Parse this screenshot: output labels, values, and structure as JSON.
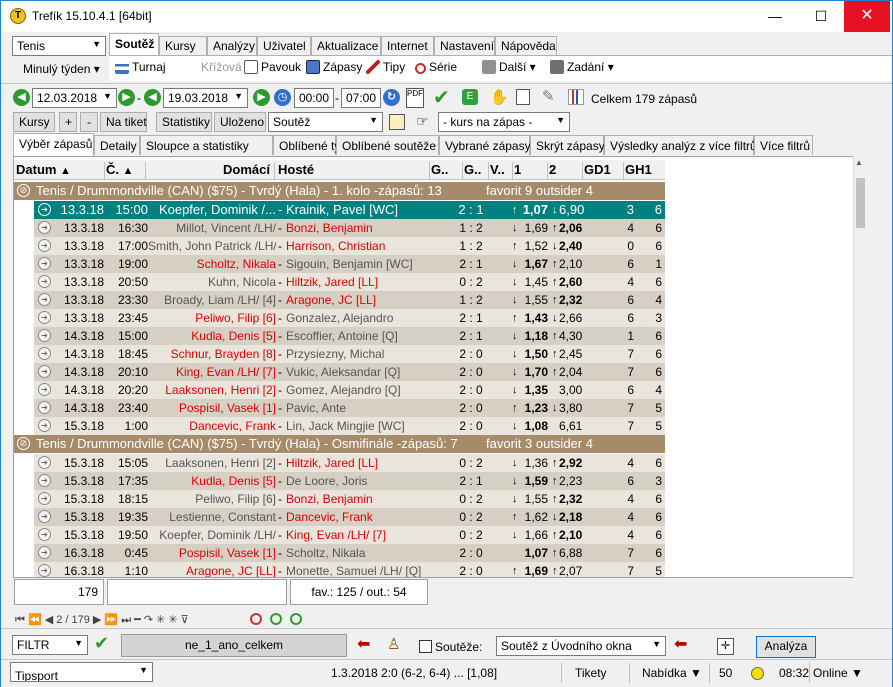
{
  "window": {
    "title": "Trefík 15.10.4.1 [64bit]",
    "minimize": "—",
    "maximize": "☐",
    "close": "✕"
  },
  "sport_select": {
    "value": "Tenis"
  },
  "period_menu": {
    "label": "Minulý týden ▾"
  },
  "menu_tabs": [
    "Soutěž",
    "Kursy",
    "Analýzy",
    "Uživatel",
    "Aktualizace",
    "Internet",
    "Nastavení",
    "Nápověda"
  ],
  "toolbar1": {
    "turnaj": "Turnaj",
    "krizova": "Křížová",
    "pavouk": "Pavouk",
    "zapasy": "Zápasy",
    "tipy": "Tipy",
    "serie": "Série",
    "dalsi": "Další ▾",
    "zadani": "Zadání ▾"
  },
  "date_from": "12.03.2018",
  "date_sep": "-",
  "date_to": "19.03.2018",
  "time_from": "00:00",
  "time_sep": "-",
  "time_to": "07:00",
  "total_label": "Celkem 179 zápasů",
  "toolbar3": {
    "kursy": "Kursy",
    "plus": "+",
    "minus": "-",
    "na_tiket": "Na tiket",
    "statistiky": "Statistiky",
    "ulozeno": "Uloženo",
    "soutez": "Soutěž",
    "kurs": "- kurs na zápas -"
  },
  "grid_tabs": [
    "Výběr zápasů",
    "Detaily",
    "Sloupce a statistiky",
    "Oblíbené týmy",
    "Oblíbené soutěže",
    "Vybrané zápasy",
    "Skrýt zápasy",
    "Výsledky analýz z více filtrů",
    "Více filtrů"
  ],
  "columns": [
    "Datum",
    "Č.",
    "Domácí",
    "Hosté",
    "G..",
    "G..",
    "V..",
    "1",
    "2",
    "GD1",
    "GH1"
  ],
  "groups": [
    {
      "title": "Tenis / Drummondville (CAN)  ($75) - Tvrdý (Hala) - 1. kolo -zápasů: 13",
      "fav": "favorit 9  outsider 4"
    },
    {
      "title": "Tenis / Drummondville (CAN)  ($75) - Tvrdý (Hala) - Osmifinále -zápasů: 7",
      "fav": "favorit 3  outsider 4"
    }
  ],
  "rows1": [
    {
      "d": "13.3.18",
      "t": "15:00",
      "h": "Koepfer, Dominik /...",
      "a": "Krainik, Pavel [WC]",
      "s": "2 : 1",
      "o1": "1,07",
      "o2": "6,90",
      "g1": "3",
      "g2": "6",
      "hc": "",
      "ac": "",
      "b": 1,
      "u1": "↑",
      "u2": "↓"
    },
    {
      "d": "13.3.18",
      "t": "16:30",
      "h": "Millot, Vincent /LH/",
      "a": "Bonzi, Benjamin",
      "s": "1 : 2",
      "o1": "1,69",
      "o2": "2,06",
      "g1": "4",
      "g2": "6",
      "hc": "gray",
      "ac": "red",
      "b": 2,
      "u1": "↓",
      "u2": "↑"
    },
    {
      "d": "13.3.18",
      "t": "17:00",
      "h": "Smith, John Patrick /LH/",
      "a": "Harrison, Christian",
      "s": "1 : 2",
      "o1": "1,52",
      "o2": "2,40",
      "g1": "0",
      "g2": "6",
      "hc": "gray",
      "ac": "red",
      "b": 2,
      "u1": "↑",
      "u2": "↓"
    },
    {
      "d": "13.3.18",
      "t": "19:00",
      "h": "Scholtz, Nikala",
      "a": "Sigouin, Benjamin [WC]",
      "s": "2 : 1",
      "o1": "1,67",
      "o2": "2,10",
      "g1": "6",
      "g2": "1",
      "hc": "red",
      "ac": "gray",
      "b": 1,
      "u1": "↓",
      "u2": "↑"
    },
    {
      "d": "13.3.18",
      "t": "20:50",
      "h": "Kuhn, Nicola",
      "a": "Hiltzik, Jared [LL]",
      "s": "0 : 2",
      "o1": "1,45",
      "o2": "2,60",
      "g1": "4",
      "g2": "6",
      "hc": "gray",
      "ac": "red",
      "b": 2,
      "u1": "↓",
      "u2": "↑"
    },
    {
      "d": "13.3.18",
      "t": "23:30",
      "h": "Broady, Liam /LH/ [4]",
      "a": "Aragone, JC [LL]",
      "s": "1 : 2",
      "o1": "1,55",
      "o2": "2,32",
      "g1": "6",
      "g2": "4",
      "hc": "gray",
      "ac": "red",
      "b": 2,
      "u1": "↓",
      "u2": "↑"
    },
    {
      "d": "13.3.18",
      "t": "23:45",
      "h": "Peliwo, Filip [6]",
      "a": "Gonzalez, Alejandro",
      "s": "2 : 1",
      "o1": "1,43",
      "o2": "2,66",
      "g1": "6",
      "g2": "3",
      "hc": "red",
      "ac": "gray",
      "b": 1,
      "u1": "↑",
      "u2": "↓"
    },
    {
      "d": "14.3.18",
      "t": "15:00",
      "h": "Kudla, Denis [5]",
      "a": "Escoffier, Antoine [Q]",
      "s": "2 : 1",
      "o1": "1,18",
      "o2": "4,30",
      "g1": "1",
      "g2": "6",
      "hc": "red",
      "ac": "gray",
      "b": 1,
      "u1": "↓",
      "u2": "↑"
    },
    {
      "d": "14.3.18",
      "t": "18:45",
      "h": "Schnur, Brayden [8]",
      "a": "Przysiezny, Michal",
      "s": "2 : 0",
      "o1": "1,50",
      "o2": "2,45",
      "g1": "7",
      "g2": "6",
      "hc": "red",
      "ac": "gray",
      "b": 1,
      "u1": "↓",
      "u2": "↑"
    },
    {
      "d": "14.3.18",
      "t": "20:10",
      "h": "King, Evan /LH/ [7]",
      "a": "Vukic, Aleksandar [Q]",
      "s": "2 : 0",
      "o1": "1,70",
      "o2": "2,04",
      "g1": "7",
      "g2": "6",
      "hc": "red",
      "ac": "gray",
      "b": 1,
      "u1": "↓",
      "u2": "↑"
    },
    {
      "d": "14.3.18",
      "t": "20:20",
      "h": "Laaksonen, Henri [2]",
      "a": "Gomez, Alejandro [Q]",
      "s": "2 : 0",
      "o1": "1,35",
      "o2": "3,00",
      "g1": "6",
      "g2": "4",
      "hc": "red",
      "ac": "gray",
      "b": 1,
      "u1": "↓",
      "u2": ""
    },
    {
      "d": "14.3.18",
      "t": "23:40",
      "h": "Pospisil, Vasek [1]",
      "a": "Pavic, Ante",
      "s": "2 : 0",
      "o1": "1,23",
      "o2": "3,80",
      "g1": "7",
      "g2": "5",
      "hc": "red",
      "ac": "gray",
      "b": 1,
      "u1": "↑",
      "u2": "↓"
    },
    {
      "d": "15.3.18",
      "t": "1:00",
      "h": "Dancevic, Frank",
      "a": "Lin, Jack Mingjie [WC]",
      "s": "2 : 0",
      "o1": "1,08",
      "o2": "6,61",
      "g1": "7",
      "g2": "5",
      "hc": "red",
      "ac": "gray",
      "b": 1,
      "u1": "↓",
      "u2": ""
    }
  ],
  "rows2": [
    {
      "d": "15.3.18",
      "t": "15:05",
      "h": "Laaksonen, Henri [2]",
      "a": "Hiltzik, Jared [LL]",
      "s": "0 : 2",
      "o1": "1,36",
      "o2": "2,92",
      "g1": "4",
      "g2": "6",
      "hc": "gray",
      "ac": "red",
      "b": 2,
      "u1": "↓",
      "u2": "↑"
    },
    {
      "d": "15.3.18",
      "t": "17:35",
      "h": "Kudla, Denis [5]",
      "a": "De Loore, Joris",
      "s": "2 : 1",
      "o1": "1,59",
      "o2": "2,23",
      "g1": "6",
      "g2": "3",
      "hc": "red",
      "ac": "gray",
      "b": 1,
      "u1": "↓",
      "u2": "↑"
    },
    {
      "d": "15.3.18",
      "t": "18:15",
      "h": "Peliwo, Filip [6]",
      "a": "Bonzi, Benjamin",
      "s": "0 : 2",
      "o1": "1,55",
      "o2": "2,32",
      "g1": "4",
      "g2": "6",
      "hc": "gray",
      "ac": "red",
      "b": 2,
      "u1": "↓",
      "u2": "↑"
    },
    {
      "d": "15.3.18",
      "t": "19:35",
      "h": "Lestienne, Constant",
      "a": "Dancevic, Frank",
      "s": "0 : 2",
      "o1": "1,62",
      "o2": "2,18",
      "g1": "4",
      "g2": "6",
      "hc": "gray",
      "ac": "red",
      "b": 2,
      "u1": "↑",
      "u2": "↓"
    },
    {
      "d": "15.3.18",
      "t": "19:50",
      "h": "Koepfer, Dominik /LH/",
      "a": "King, Evan /LH/ [7]",
      "s": "0 : 2",
      "o1": "1,66",
      "o2": "2,10",
      "g1": "4",
      "g2": "6",
      "hc": "gray",
      "ac": "red",
      "b": 2,
      "u1": "↓",
      "u2": "↑"
    },
    {
      "d": "16.3.18",
      "t": "0:45",
      "h": "Pospisil, Vasek [1]",
      "a": "Scholtz, Nikala",
      "s": "2 : 0",
      "o1": "1,07",
      "o2": "6,88",
      "g1": "7",
      "g2": "6",
      "hc": "red",
      "ac": "gray",
      "b": 1,
      "u1": "",
      "u2": "↑"
    },
    {
      "d": "16.3.18",
      "t": "1:10",
      "h": "Aragone, JC [LL]",
      "a": "Monette, Samuel /LH/ [Q]",
      "s": "2 : 0",
      "o1": "1,69",
      "o2": "2,07",
      "g1": "7",
      "g2": "5",
      "hc": "red",
      "ac": "gray",
      "b": 1,
      "u1": "↑",
      "u2": "↑"
    }
  ],
  "summary": {
    "count": "179",
    "extra": "",
    "favout": "fav.: 125 / out.: 54"
  },
  "navbar": "⏮ ⏪ ◀  2 / 179  ▶ ⏩ ⏭  ━  ↷  ✳  ✳  ⊽",
  "filter": {
    "label": "FILTR",
    "name": "ne_1_ano_celkem",
    "souteze_label": "Soutěže:",
    "souteze_value": "Soutěž z Úvodního okna",
    "analyza": "Analýza"
  },
  "statusbar": {
    "provider": "Tipsport",
    "info": "1.3.2018 2:0 (6-2, 6-4) ... [1,08]",
    "tikety": "Tikety",
    "nabidka": "Nabídka ▼",
    "count": "50",
    "time": "08:32",
    "online": "Online ▼"
  }
}
